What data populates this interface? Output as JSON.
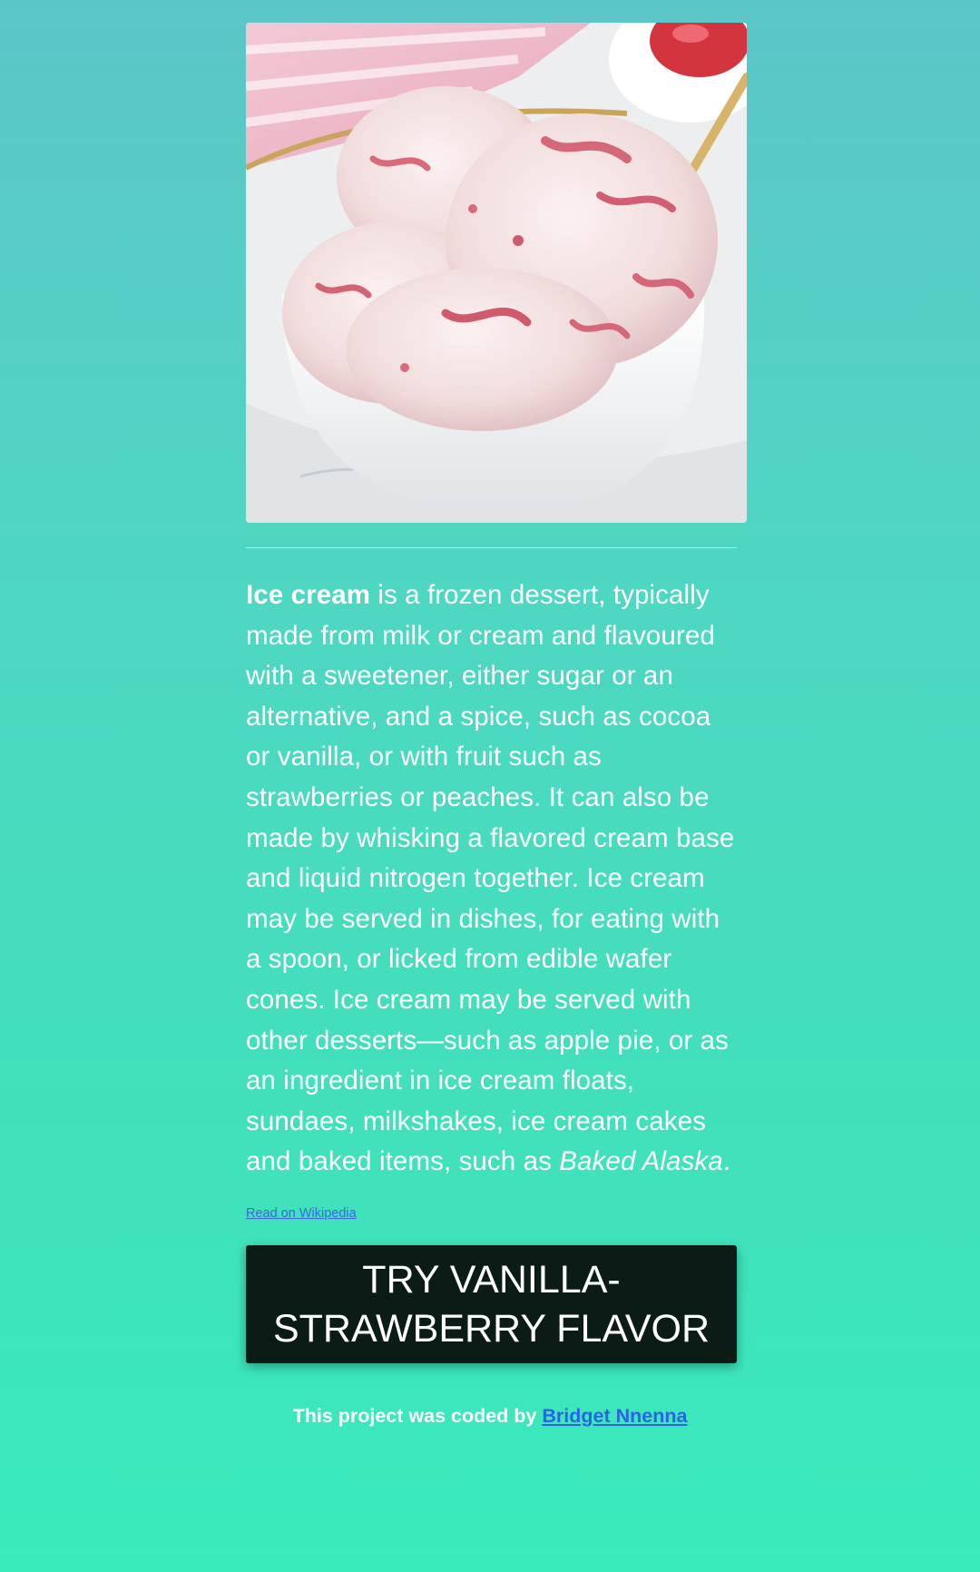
{
  "hero": {
    "image_alt": "Bowl of vanilla-strawberry ice cream"
  },
  "article": {
    "bold_term": "Ice cream",
    "body_text": " is a frozen dessert, typically made from milk or cream and flavoured with a sweetener, either sugar or an alternative, and a spice, such as cocoa or vanilla, or with fruit such as strawberries or peaches. It can also be made by whisking a flavored cream base and liquid nitrogen together. Ice cream may be served in dishes, for eating with a spoon, or licked from edible wafer cones. Ice cream may be served with other desserts—such as apple pie, or as an ingredient in ice cream floats, sundaes, milkshakes, ice cream cakes and baked items, such as ",
    "italic_term": "Baked Alaska",
    "end_punct": ".",
    "link_label": "Read on Wikipedia"
  },
  "cta": {
    "label": "TRY VANILLA-STRAWBERRY FLAVOR"
  },
  "footer": {
    "prefix": "This project was coded by ",
    "author": "Bridget Nnenna"
  },
  "colors": {
    "gradient_top": "#5cc5c8",
    "gradient_bottom": "#39ebbb",
    "button_bg": "#0b1c17",
    "link": "#2b62e8"
  }
}
